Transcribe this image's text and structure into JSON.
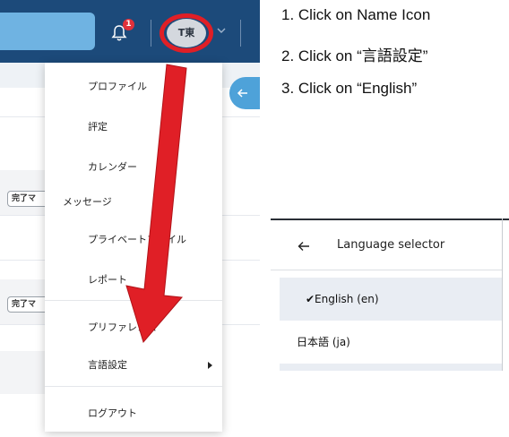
{
  "app_screenshot": {
    "header": {
      "notification_count": "1",
      "avatar_initials": "T東"
    },
    "status_pills": [
      "完了マ",
      "完了マ"
    ],
    "user_menu": {
      "items": [
        {
          "label": "プロファイル"
        },
        {
          "label": "評定"
        },
        {
          "label": "カレンダー"
        },
        {
          "label": "メッセージ"
        },
        {
          "label": "プライベートファイル"
        },
        {
          "label": "レポート"
        },
        {
          "label": "プリファレンス"
        },
        {
          "label": "言語設定",
          "has_submenu": true
        },
        {
          "label": "ログアウト"
        }
      ]
    }
  },
  "instructions": {
    "steps": [
      "1. Click on Name Icon",
      "2. Click on “言語設定”",
      "3. Click on “English”"
    ]
  },
  "language_selector": {
    "title": "Language selector",
    "options": [
      {
        "label": "✔English (en)",
        "selected": true
      },
      {
        "label": "日本語 (ja)",
        "selected": false
      }
    ]
  },
  "colors": {
    "topbar": "#1c4a7a",
    "search_box": "#6fb3e2",
    "highlight_red": "#e01f26",
    "badge_red": "#e0313b",
    "collapse_button": "#4ea2d9",
    "selected_row": "#e9edf3"
  },
  "icons": [
    "bell-icon",
    "chevron-down-icon",
    "arrow-left-icon",
    "caret-right-icon",
    "back-arrow-icon"
  ]
}
